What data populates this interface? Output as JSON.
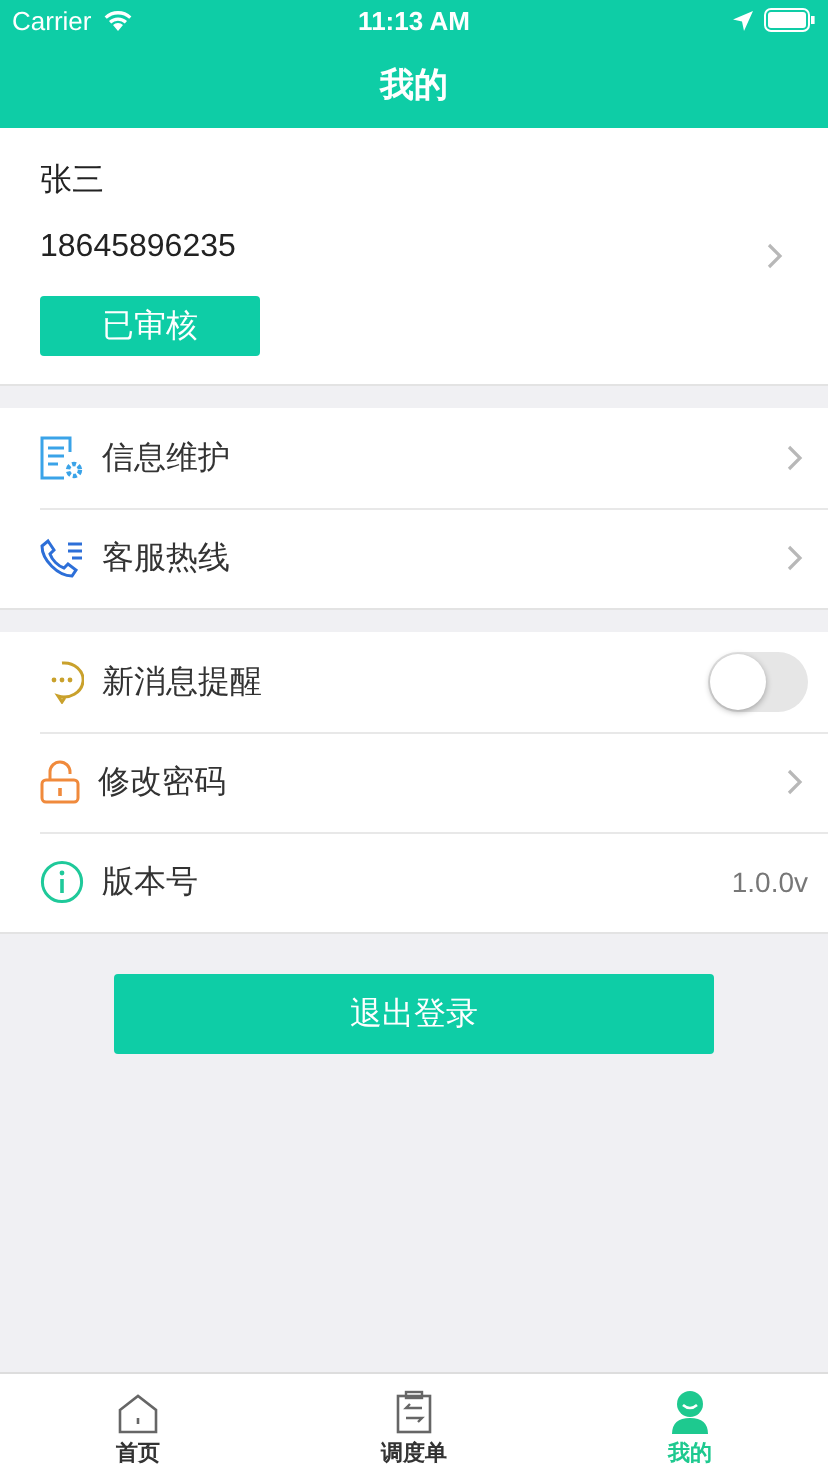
{
  "status_bar": {
    "carrier": "Carrier",
    "time": "11:13 AM"
  },
  "header": {
    "title": "我的"
  },
  "profile": {
    "name": "张三",
    "phone": "18645896235",
    "badge": "已审核"
  },
  "groups": [
    {
      "rows": [
        {
          "kind": "link",
          "label": "信息维护"
        },
        {
          "kind": "link",
          "label": "客服热线"
        }
      ]
    },
    {
      "rows": [
        {
          "kind": "toggle",
          "label": "新消息提醒",
          "on": false
        },
        {
          "kind": "link",
          "label": "修改密码"
        },
        {
          "kind": "value",
          "label": "版本号",
          "value": "1.0.0v"
        }
      ]
    }
  ],
  "logout_button": "退出登录",
  "tabs": [
    {
      "label": "首页",
      "selected": false
    },
    {
      "label": "调度单",
      "selected": false
    },
    {
      "label": "我的",
      "selected": true
    }
  ]
}
